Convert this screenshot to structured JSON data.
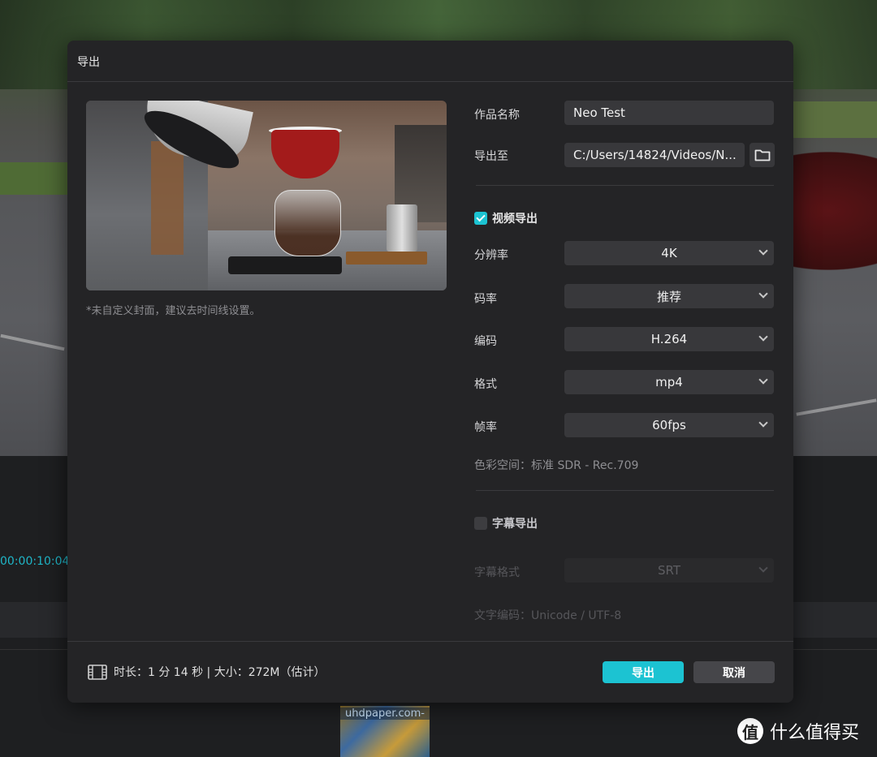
{
  "background": {
    "timecode": "00:00:10:04",
    "clip_label": "uhdpaper.com-",
    "watermark": "什么值得买",
    "watermark_logo": "值"
  },
  "dialog": {
    "title": "导出",
    "cover_note": "*未自定义封面，建议去时间线设置。",
    "work_name": {
      "label": "作品名称",
      "value": "Neo Test"
    },
    "export_to": {
      "label": "导出至",
      "value": "C:/Users/14824/Videos/N...",
      "icon": "folder-icon"
    },
    "video_export": {
      "label": "视频导出",
      "checked": true,
      "resolution": {
        "label": "分辨率",
        "value": "4K"
      },
      "bitrate": {
        "label": "码率",
        "value": "推荐"
      },
      "codec": {
        "label": "编码",
        "value": "H.264"
      },
      "format": {
        "label": "格式",
        "value": "mp4"
      },
      "framerate": {
        "label": "帧率",
        "value": "60fps"
      },
      "color_space": "色彩空间：标准 SDR - Rec.709"
    },
    "subtitle_export": {
      "label": "字幕导出",
      "checked": false,
      "format": {
        "label": "字幕格式",
        "value": "SRT"
      },
      "encoding": "文字编码：Unicode / UTF-8"
    },
    "footer": {
      "icon": "film-icon",
      "info": "时长：1 分 14 秒 | 大小：272M（估计）",
      "export_label": "导出",
      "cancel_label": "取消"
    },
    "colors": {
      "accent": "#1cc3d2",
      "panel": "#242426",
      "field": "#38383b"
    }
  }
}
